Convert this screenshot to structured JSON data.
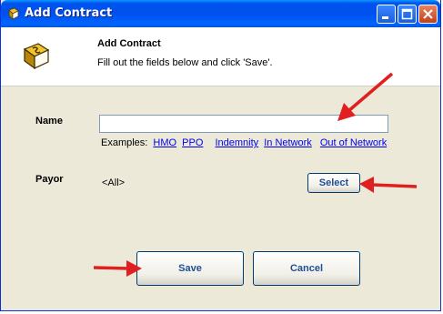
{
  "window": {
    "title": "Add Contract"
  },
  "header": {
    "title": "Add Contract",
    "subtitle": "Fill out the fields below and click 'Save'."
  },
  "form": {
    "name_label": "Name",
    "name_value": "",
    "examples_label": "Examples:",
    "examples": [
      "HMO",
      "PPO",
      "Indemnity",
      "In Network",
      "Out of Network"
    ],
    "payor_label": "Payor",
    "payor_value": "<All>",
    "select_label": "Select"
  },
  "footer": {
    "save_label": "Save",
    "cancel_label": "Cancel"
  },
  "colors": {
    "titlebar": "#0053ee",
    "dialog_bg": "#ece9d8",
    "link": "#0000ee",
    "button_text": "#234f93",
    "annotation_arrow": "#e02020"
  }
}
